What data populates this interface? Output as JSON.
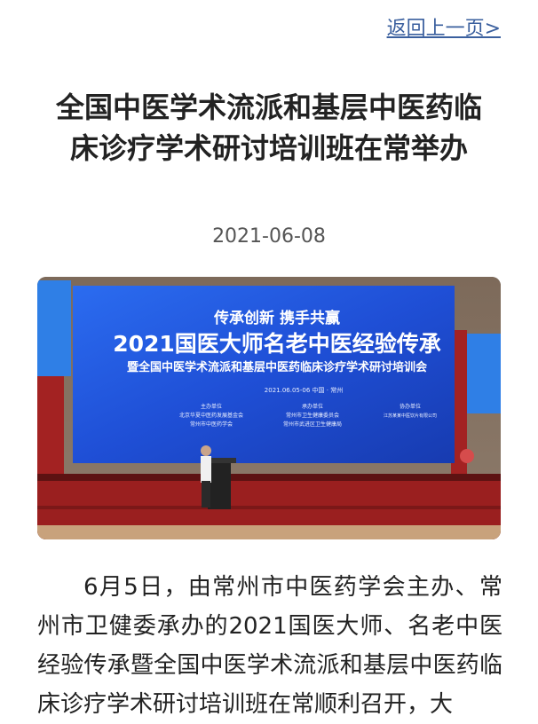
{
  "nav": {
    "back_label": "返回上一页>"
  },
  "article": {
    "title": "全国中医学术流派和基层中医药临床诊疗学术研讨培训班在常举办",
    "date": "2021-06-08",
    "body": "6月5日，由常州市中医药学会主办、常州市卫健委承办的2021国医大师、名老中医经验传承暨全国中医学术流派和基层中医药临床诊疗学术研讨培训班在常顺利召开，大"
  },
  "photo": {
    "banner_slogan": "传承创新  携手共赢",
    "banner_main": "2021国医大师名老中医经验传承",
    "banner_sub": "暨全国中医学术流派和基层中医药临床诊疗学术研讨培训会",
    "banner_date": "2021.06.05-06  中国 · 常州",
    "host_label": "主办单位",
    "host_1": "北京华夏中医药发展基金会",
    "host_2": "常州市中医药学会",
    "organizer_label": "承办单位",
    "organizer_1": "常州市卫生健康委员会",
    "organizer_2": "常州市武进区卫生健康局",
    "co_label": "协办单位",
    "co_1": "江苏某某中医饮片有限公司"
  },
  "colors": {
    "link": "#3a5f9e",
    "banner_blue": "#1f4fd6",
    "stage_red": "#9a1f1f"
  }
}
